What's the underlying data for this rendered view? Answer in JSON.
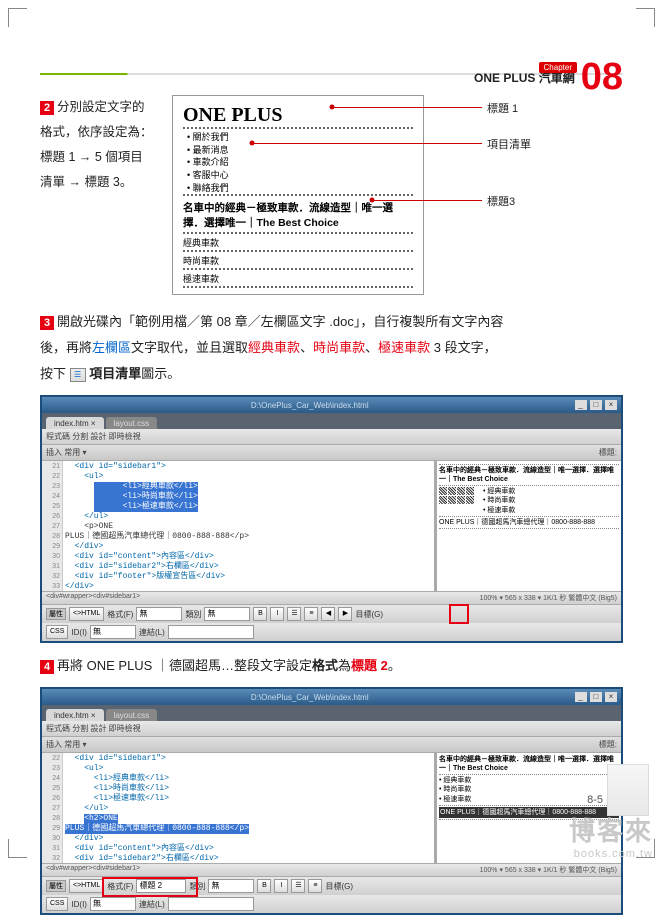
{
  "header": {
    "title": "ONE PLUS 汽車網",
    "chapter_label": "Chapter",
    "chapter_num": "08"
  },
  "step2": {
    "num": "2",
    "text_l1": "分別設定文字的",
    "text_l2": "格式，依序設定為：",
    "text_l3": "標題 1 → 5 個項目",
    "text_l4": "清單 → 標題 3。"
  },
  "preview": {
    "h1": "ONE PLUS",
    "menu": [
      "關於我們",
      "最新消息",
      "車款介紹",
      "客服中心",
      "聯絡我們"
    ],
    "h3": "名車中的經典－極致車款．流線造型｜唯一選擇．選擇唯一｜The Best Choice",
    "sub": [
      "經典車款",
      "時尚車款",
      "極速車款"
    ]
  },
  "callouts": {
    "c1": "標題 1",
    "c2": "項目清單",
    "c3": "標題3"
  },
  "step3": {
    "num": "3",
    "l1a": "開啟光碟內「範例用檔／第 08 章／左欄區文字 .doc」，自行複製所有文字內容",
    "l2a": "後，再將",
    "l2b": "左欄區",
    "l2c": "文字取代，並且選取",
    "l2d": "經典車款",
    "l2e": "、",
    "l2f": "時尚車款",
    "l2g": "、",
    "l2h": "極速車款",
    "l2i": " 3 段文字，",
    "l3a": "按下 ",
    "l3b": " 項目清單",
    "l3c": "圖示。"
  },
  "step4": {
    "num": "4",
    "l1a": "再將 ONE PLUS ｜德國超馬…整段文字設定",
    "l1b": "格式",
    "l1c": "為",
    "l1d": "標題 2",
    "l1e": "。"
  },
  "shot": {
    "tab1": "index.htm ×",
    "tab2": "layout.css",
    "path": "D:\\OnePlus_Car_Web\\index.html",
    "viewtabs": "程式碼  分割  設計  即時檢視",
    "toolbar_right": "標題: ",
    "insert_menu": "插入  常用 ▾",
    "gutter": [
      "21",
      "22",
      "23",
      "24",
      "25",
      "26",
      "27",
      "28",
      "29",
      "30",
      "31",
      "32",
      "33"
    ],
    "code_lines": [
      "  <div id=\"sidebar1\">",
      "    <ul>",
      "      <li>經典車款</li>",
      "      <li>時尚車款</li>",
      "      <li>極速車款</li>",
      "    </ul>",
      "    <p>ONE",
      "PLUS｜德國超馬汽車總代理｜0800-888-888</p>",
      "  </div>",
      "  <div id=\"content\">內容區</div>",
      "  <div id=\"sidebar2\">右欄區</div>",
      "  <div id=\"footer\">版權宣告區</div>",
      "</div>"
    ],
    "preview_h3": "名車中的經典－極致車款．流線造型｜唯一選擇．選擇唯一｜The Best Choice",
    "preview_items": [
      "經典車款",
      "時尚車款",
      "極速車款"
    ],
    "preview_foot": "ONE PLUS｜德國超馬汽車總代理｜0800-888-888",
    "status_left": "<div#wrapper><div#sidebar1>",
    "status_right": "100%  ▾  565 x 338 ▾  1K/1 秒  繁體中文 (Big5)",
    "props_collapse": "屬性",
    "props_html": "<>HTML",
    "props_css": "CSS",
    "props_fmt_lbl": "格式(F)",
    "props_fmt_val1": "無",
    "props_fmt_val2": "標題 2",
    "props_id_lbl": "ID(I)",
    "props_id_val": "無",
    "props_cls_lbl": "類別",
    "props_cls_val": "無",
    "props_link_lbl": "連結(L)",
    "props_bold": "B",
    "props_italic": "I",
    "props_tgt_lbl": "目標(G)"
  },
  "shot2_preview_hl": "ONE PLUS｜德國超馬汽車總代理｜0800-888-888",
  "page_num": "8-5",
  "watermark": {
    "big": "博客來",
    "small": "books.com.tw"
  }
}
